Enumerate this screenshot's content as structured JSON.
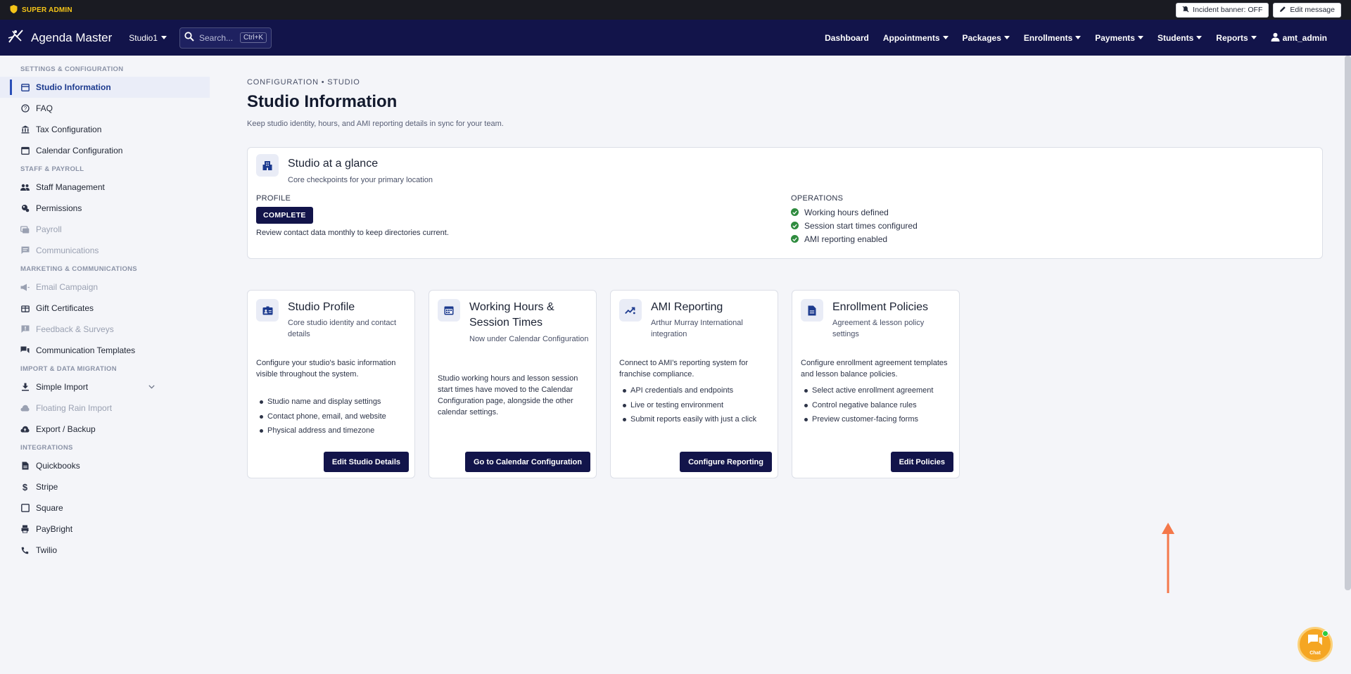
{
  "admin_strip": {
    "badge": "SUPER ADMIN",
    "incident_banner": "Incident banner: OFF",
    "edit_message": "Edit message"
  },
  "navbar": {
    "brand": "Agenda Master",
    "studio": "Studio1",
    "search_placeholder": "Search...",
    "search_shortcut": "Ctrl+K",
    "menu": [
      {
        "label": "Dashboard"
      },
      {
        "label": "Appointments"
      },
      {
        "label": "Packages"
      },
      {
        "label": "Enrollments"
      },
      {
        "label": "Payments"
      },
      {
        "label": "Students"
      },
      {
        "label": "Reports"
      }
    ],
    "user": "amt_admin"
  },
  "sidebar": {
    "sections": [
      {
        "title": "SETTINGS & CONFIGURATION",
        "items": [
          {
            "label": "Studio Information",
            "icon": "storefront-icon"
          },
          {
            "label": "FAQ",
            "icon": "help-circle-icon"
          },
          {
            "label": "Tax Configuration",
            "icon": "bank-icon"
          },
          {
            "label": "Calendar Configuration",
            "icon": "calendar-icon"
          }
        ]
      },
      {
        "title": "STAFF & PAYROLL",
        "items": [
          {
            "label": "Staff Management",
            "icon": "people-icon"
          },
          {
            "label": "Permissions",
            "icon": "key-icon"
          },
          {
            "label": "Payroll",
            "icon": "payroll-icon"
          },
          {
            "label": "Communications",
            "icon": "chat-icon"
          }
        ]
      },
      {
        "title": "MARKETING & COMMUNICATIONS",
        "items": [
          {
            "label": "Email Campaign",
            "icon": "campaign-icon"
          },
          {
            "label": "Gift Certificates",
            "icon": "gift-icon"
          },
          {
            "label": "Feedback & Surveys",
            "icon": "feedback-icon"
          },
          {
            "label": "Communication Templates",
            "icon": "forum-icon"
          }
        ]
      },
      {
        "title": "IMPORT & DATA MIGRATION",
        "items": [
          {
            "label": "Simple Import",
            "icon": "download-icon"
          },
          {
            "label": "Floating Rain Import",
            "icon": "cloud-icon"
          },
          {
            "label": "Export / Backup",
            "icon": "cloud-upload-icon"
          }
        ]
      },
      {
        "title": "INTEGRATIONS",
        "items": [
          {
            "label": "Quickbooks",
            "icon": "document-icon"
          },
          {
            "label": "Stripe",
            "icon": "dollar-icon"
          },
          {
            "label": "Square",
            "icon": "square-icon"
          },
          {
            "label": "PayBright",
            "icon": "printer-icon"
          },
          {
            "label": "Twilio",
            "icon": "phone-icon"
          }
        ]
      }
    ]
  },
  "page": {
    "eyebrow": "CONFIGURATION • STUDIO",
    "title": "Studio Information",
    "subtitle": "Keep studio identity, hours, and AMI reporting details in sync for your team."
  },
  "glance": {
    "title": "Studio at a glance",
    "subtitle": "Core checkpoints for your primary location",
    "profile_label": "PROFILE",
    "profile_status": "COMPLETE",
    "profile_note": "Review contact data monthly to keep directories current.",
    "operations_label": "OPERATIONS",
    "operations": [
      "Working hours defined",
      "Session start times configured",
      "AMI reporting enabled"
    ],
    "check_color": "#2e8b3e"
  },
  "cards": [
    {
      "title": "Studio Profile",
      "subtitle": "Core studio identity and contact details",
      "description": "Configure your studio's basic information visible throughout the system.",
      "bullets": [
        "Studio name and display settings",
        "Contact phone, email, and website",
        "Physical address and timezone"
      ],
      "button": "Edit Studio Details",
      "icon": "id-card-icon"
    },
    {
      "title": "Working Hours & Session Times",
      "subtitle": "Now under Calendar Configuration",
      "description": "Studio working hours and lesson session start times have moved to the Calendar Configuration page, alongside the other calendar settings.",
      "bullets": [],
      "button": "Go to Calendar Configuration",
      "icon": "calendar-icon"
    },
    {
      "title": "AMI Reporting",
      "subtitle": "Arthur Murray International integration",
      "description": "Connect to AMI's reporting system for franchise compliance.",
      "bullets": [
        "API credentials and endpoints",
        "Live or testing environment",
        "Submit reports easily with just a click"
      ],
      "button": "Configure Reporting",
      "icon": "trending-up-icon"
    },
    {
      "title": "Enrollment Policies",
      "subtitle": "Agreement & lesson policy settings",
      "description": "Configure enrollment agreement templates and lesson balance policies.",
      "bullets": [
        "Select active enrollment agreement",
        "Control negative balance rules",
        "Preview customer-facing forms"
      ],
      "button": "Edit Policies",
      "icon": "document-icon"
    }
  ],
  "chat": {
    "label": "Chat"
  },
  "colors": {
    "navy": "#12144a",
    "accent_arrow": "#f4784a",
    "admin_gold": "#f5c518"
  }
}
